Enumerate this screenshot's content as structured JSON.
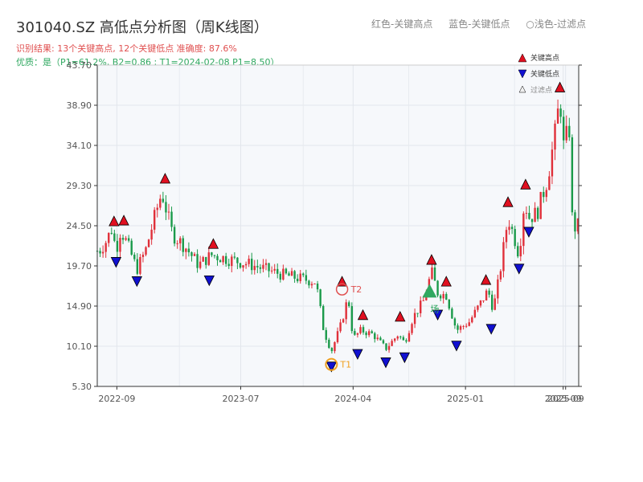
{
  "header": {
    "title": "301040.SZ 高低点分析图（周K线图）",
    "legend_items": [
      "红色-关键高点",
      "蓝色-关键低点",
      "○浅色-过滤点"
    ],
    "stats_line": "识别结果: 13个关键高点, 12个关键低点  准确度: 87.6%",
    "quality_line": "优质：是（P1=61.2%, B2=0.86 ; T1=2024-02-08 P1=8.50）"
  },
  "colors": {
    "up": "#e0303a",
    "down": "#1a9a4a",
    "high": "#e01020",
    "low": "#1010d0",
    "filtered": "#f0f0f0",
    "accent_orange": "#f0a020",
    "accent_green": "#2fa860"
  },
  "chart_data": {
    "type": "candlestick",
    "y_ticks": [
      "5.30",
      "10.10",
      "14.90",
      "19.70",
      "24.50",
      "29.30",
      "34.10",
      "38.90",
      "43.70"
    ],
    "ylim": [
      5.3,
      43.7
    ],
    "x_tick_labels": [
      "2022-09",
      "2023-07",
      "2024-04",
      "2025-01",
      "2025-09",
      "2025-09"
    ],
    "x_tick_dates": [
      "2022-09",
      "2023-07",
      "2024-04",
      "2025-01",
      "2025-09",
      "2025-09"
    ],
    "legend": [
      "关键高点",
      "关键低点",
      "过滤点"
    ],
    "anchors": [
      {
        "date": "2022-07-20",
        "close": 21.5
      },
      {
        "date": "2022-08-05",
        "close": 22.6
      },
      {
        "date": "2022-08-20",
        "close": 24.2
      },
      {
        "date": "2022-08-30",
        "close": 21.5
      },
      {
        "date": "2022-09-10",
        "close": 24.0
      },
      {
        "date": "2022-09-25",
        "close": 22.5
      },
      {
        "date": "2022-10-20",
        "close": 19.3
      },
      {
        "date": "2022-11-10",
        "close": 21.5
      },
      {
        "date": "2022-12-05",
        "close": 26.0
      },
      {
        "date": "2022-12-20",
        "close": 28.5
      },
      {
        "date": "2023-01-15",
        "close": 23.5
      },
      {
        "date": "2023-02-15",
        "close": 22.0
      },
      {
        "date": "2023-03-20",
        "close": 19.8
      },
      {
        "date": "2023-04-20",
        "close": 21.0
      },
      {
        "date": "2023-07-15",
        "close": 20.0
      },
      {
        "date": "2023-10-15",
        "close": 18.6
      },
      {
        "date": "2024-01-01",
        "close": 17.8
      },
      {
        "date": "2024-01-20",
        "close": 12.0
      },
      {
        "date": "2024-02-08",
        "close": 9.5
      },
      {
        "date": "2024-03-01",
        "close": 12.5
      },
      {
        "date": "2024-03-20",
        "close": 16.0
      },
      {
        "date": "2024-04-01",
        "close": 11.0
      },
      {
        "date": "2024-04-20",
        "close": 12.0
      },
      {
        "date": "2024-05-20",
        "close": 11.5
      },
      {
        "date": "2024-06-20",
        "close": 9.8
      },
      {
        "date": "2024-07-20",
        "close": 11.5
      },
      {
        "date": "2024-08-05",
        "close": 10.5
      },
      {
        "date": "2024-08-25",
        "close": 13.5
      },
      {
        "date": "2024-09-20",
        "close": 15.5
      },
      {
        "date": "2024-10-10",
        "close": 19.0
      },
      {
        "date": "2024-10-25",
        "close": 16.5
      },
      {
        "date": "2024-11-15",
        "close": 16.2
      },
      {
        "date": "2024-12-10",
        "close": 12.0
      },
      {
        "date": "2025-01-10",
        "close": 13.0
      },
      {
        "date": "2025-02-10",
        "close": 15.5
      },
      {
        "date": "2025-02-25",
        "close": 16.8
      },
      {
        "date": "2025-03-10",
        "close": 14.5
      },
      {
        "date": "2025-03-25",
        "close": 18.5
      },
      {
        "date": "2025-04-15",
        "close": 25.5
      },
      {
        "date": "2025-05-01",
        "close": 23.0
      },
      {
        "date": "2025-05-12",
        "close": 21.0
      },
      {
        "date": "2025-05-25",
        "close": 27.5
      },
      {
        "date": "2025-06-05",
        "close": 25.5
      },
      {
        "date": "2025-06-25",
        "close": 26.0
      },
      {
        "date": "2025-07-20",
        "close": 30.0
      },
      {
        "date": "2025-08-10",
        "close": 36.0
      },
      {
        "date": "2025-08-20",
        "close": 40.0
      },
      {
        "date": "2025-09-01",
        "close": 32.0
      },
      {
        "date": "2025-09-10",
        "close": 39.0
      },
      {
        "date": "2025-09-20",
        "close": 24.0
      },
      {
        "date": "2025-09-30",
        "close": 24.5
      }
    ],
    "key_highs": [
      {
        "date": "2022-08-25",
        "price": 24.2
      },
      {
        "date": "2022-09-18",
        "price": 24.3
      },
      {
        "date": "2022-12-28",
        "price": 29.3
      },
      {
        "date": "2023-04-25",
        "price": 21.5
      },
      {
        "date": "2024-04-25",
        "price": 13.0
      },
      {
        "date": "2024-07-25",
        "price": 12.8
      },
      {
        "date": "2024-10-10",
        "price": 19.6
      },
      {
        "date": "2024-11-15",
        "price": 17.0
      },
      {
        "date": "2025-02-20",
        "price": 17.2
      },
      {
        "date": "2025-04-15",
        "price": 26.5
      },
      {
        "date": "2025-05-28",
        "price": 28.6
      },
      {
        "date": "2025-08-20",
        "price": 40.2
      },
      {
        "date": "2024-03-05",
        "price": 17.0
      }
    ],
    "key_lows": [
      {
        "date": "2022-08-30",
        "price": 21.0
      },
      {
        "date": "2022-10-20",
        "price": 18.7
      },
      {
        "date": "2023-04-15",
        "price": 18.8
      },
      {
        "date": "2024-02-08",
        "price": 8.5
      },
      {
        "date": "2024-04-12",
        "price": 10.0
      },
      {
        "date": "2024-06-20",
        "price": 9.0
      },
      {
        "date": "2024-08-05",
        "price": 9.6
      },
      {
        "date": "2024-10-25",
        "price": 14.7
      },
      {
        "date": "2024-12-10",
        "price": 11.0
      },
      {
        "date": "2025-03-05",
        "price": 13.0
      },
      {
        "date": "2025-05-12",
        "price": 20.2
      },
      {
        "date": "2025-06-05",
        "price": 24.6
      }
    ],
    "annotations": [
      {
        "label": "T1",
        "date": "2024-02-08",
        "price": 8.5
      },
      {
        "label": "T2",
        "date": "2024-03-05",
        "price": 17.0
      },
      {
        "label": "场",
        "date": "2024-10-05",
        "price": 16.5
      }
    ]
  }
}
